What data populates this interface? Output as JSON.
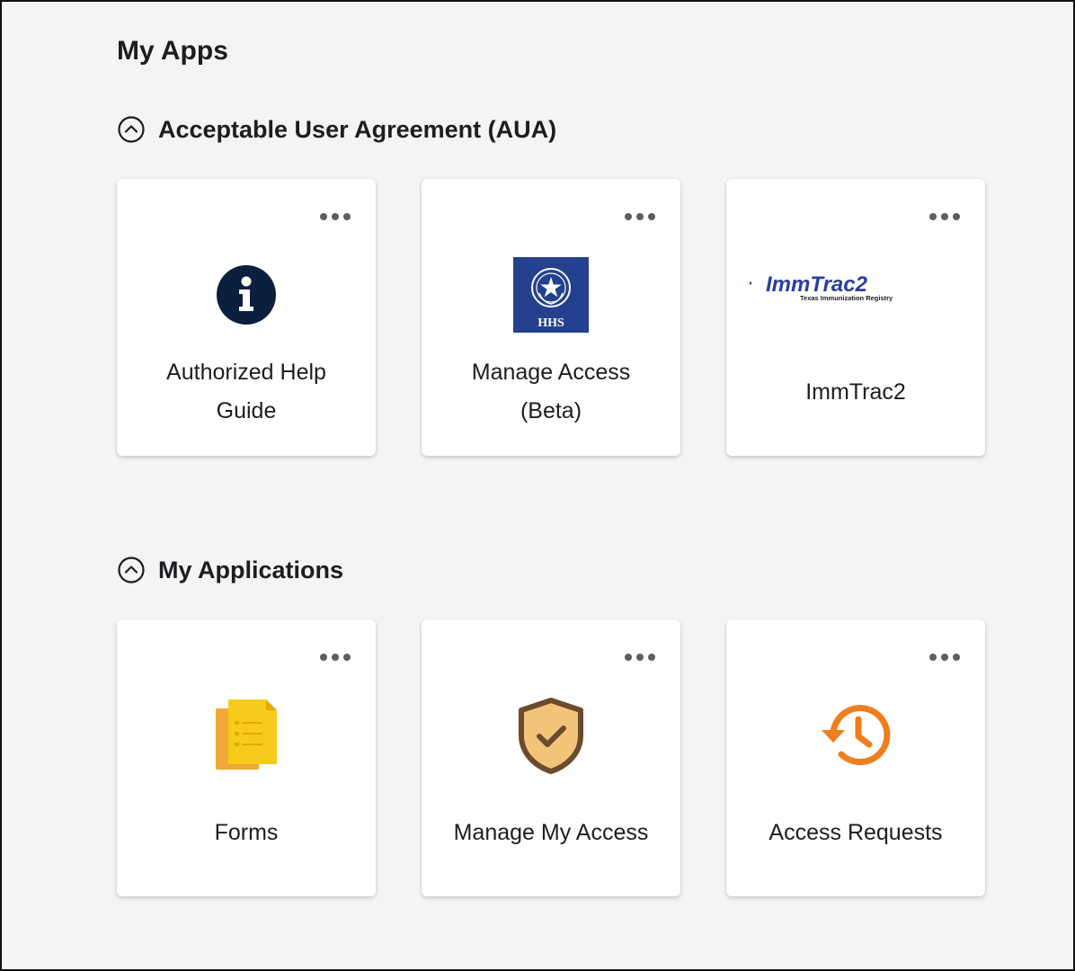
{
  "page": {
    "title": "My Apps"
  },
  "sections": [
    {
      "title": "Acceptable User Agreement (AUA)",
      "tiles": [
        {
          "label": "Authorized Help Guide",
          "icon": "info-icon"
        },
        {
          "label": "Manage Access (Beta)",
          "icon": "hhs-seal-logo",
          "logo_text": "HHS"
        },
        {
          "label": "ImmTrac2",
          "icon": "immtrac2-logo",
          "logo_text": "ImmTrac2",
          "logo_subtext": "Texas Immunization Registry"
        }
      ]
    },
    {
      "title": "My Applications",
      "tiles": [
        {
          "label": "Forms",
          "icon": "forms-icon"
        },
        {
          "label": "Manage My Access",
          "icon": "shield-check-icon"
        },
        {
          "label": "Access Requests",
          "icon": "history-clock-icon"
        }
      ]
    }
  ],
  "colors": {
    "background": "#f4f4f4",
    "text": "#1d1d21",
    "hhs_blue": "#23418f",
    "immtrac_blue": "#2a3f9a",
    "forms_yellow": "#f5c518",
    "shield_tan": "#f2c47a",
    "shield_brown": "#6b4a2e",
    "history_orange": "#f07d1e"
  }
}
